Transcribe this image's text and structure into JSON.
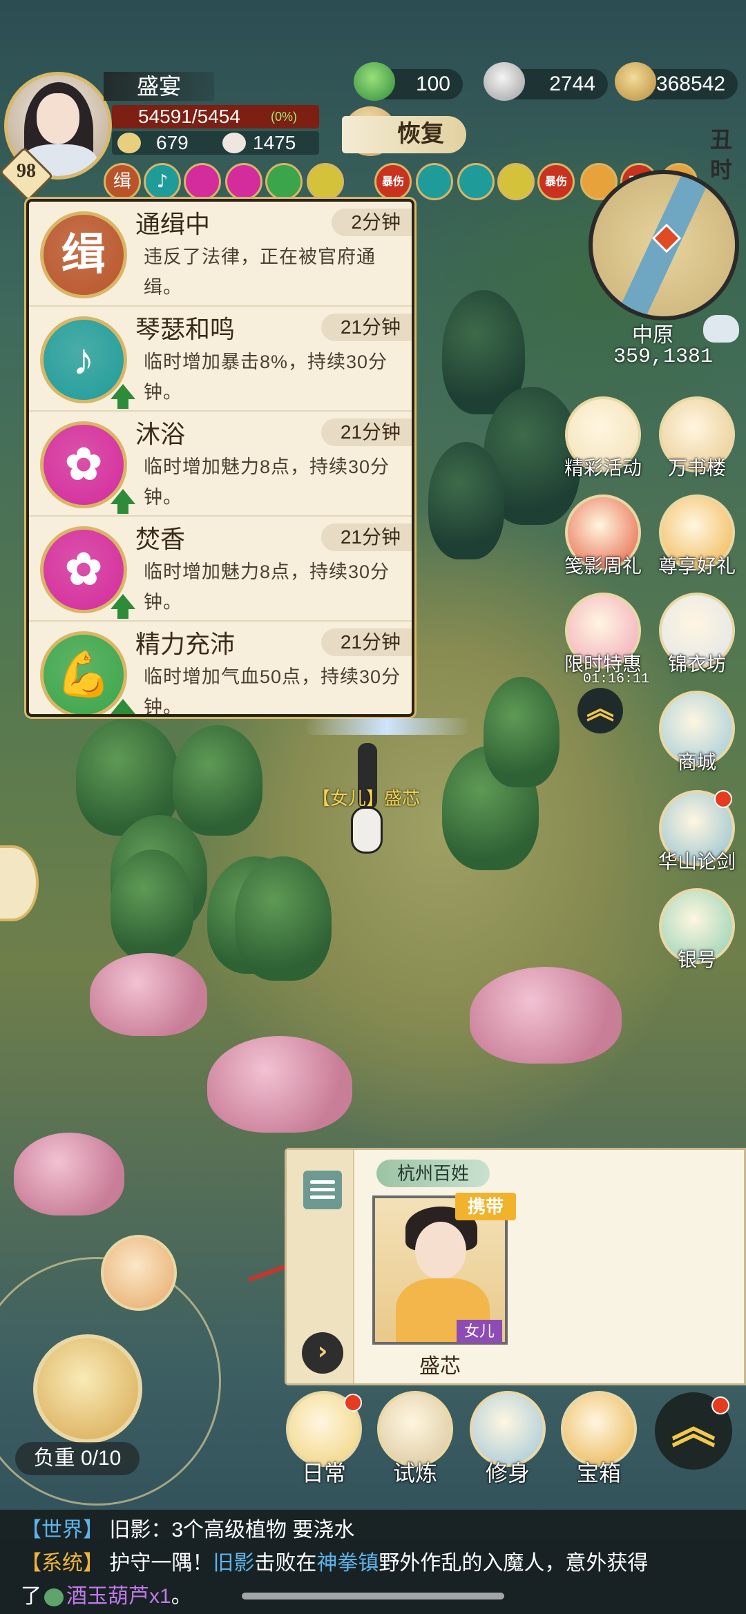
{
  "player": {
    "name": "盛宴",
    "level": "98",
    "hp": "54591/5454",
    "hp_percent": "(0%)",
    "stat1": "679",
    "stat2": "1475"
  },
  "resources": {
    "jade": "100",
    "silver": "2744",
    "coins": "368542"
  },
  "restore_label": "恢复",
  "time_label": "丑时",
  "buffs": [
    {
      "name": "缉",
      "icon": "wanted-icon",
      "color": "#b9542a"
    },
    {
      "name": "♪",
      "icon": "music-note-icon",
      "color": "#1f9c9a"
    },
    {
      "name": "",
      "icon": "blossom-icon",
      "color": "#d42b9d"
    },
    {
      "name": "",
      "icon": "blossom-icon",
      "color": "#d42b9d"
    },
    {
      "name": "",
      "icon": "strength-icon",
      "color": "#3aa54a"
    },
    {
      "name": "",
      "icon": "bowl-icon",
      "color": "#d4c23a"
    },
    {
      "name": "暴伤",
      "icon": "crit-icon",
      "color": "#c8321f"
    },
    {
      "name": "",
      "icon": "feather-icon",
      "color": "#1f9c9a"
    },
    {
      "name": "",
      "icon": "feather-icon",
      "color": "#1f9c9a"
    },
    {
      "name": "",
      "icon": "bowl-icon",
      "color": "#d4c23a"
    },
    {
      "name": "暴伤",
      "icon": "crit-icon",
      "color": "#c8321f"
    },
    {
      "name": "",
      "icon": "sword-icon",
      "color": "#e7a23b"
    },
    {
      "name": "暴伤",
      "icon": "crit-icon",
      "color": "#c8321f"
    },
    {
      "name": "",
      "icon": "sword-icon",
      "color": "#e7a23b"
    }
  ],
  "buff_panel": [
    {
      "title": "通缉中",
      "time": "2分钟",
      "desc": "违反了法律，正在被官府通缉。",
      "glyph": "缉",
      "color": "#b9542a",
      "arrow": false
    },
    {
      "title": "琴瑟和鸣",
      "time": "21分钟",
      "desc": "临时增加暴击8%，持续30分钟。",
      "glyph": "♪",
      "color": "#1f9c9a",
      "arrow": true
    },
    {
      "title": "沐浴",
      "time": "21分钟",
      "desc": "临时增加魅力8点，持续30分钟。",
      "glyph": "✿",
      "color": "#d42b9d",
      "arrow": true
    },
    {
      "title": "焚香",
      "time": "21分钟",
      "desc": "临时增加魅力8点，持续30分钟。",
      "glyph": "✿",
      "color": "#d42b9d",
      "arrow": true
    },
    {
      "title": "精力充沛",
      "time": "21分钟",
      "desc": "临时增加气血50点，持续30分钟。",
      "glyph": "💪",
      "color": "#3aa54a",
      "arrow": true
    }
  ],
  "minimap": {
    "region": "中原",
    "coords": "359,1381"
  },
  "side_menu": [
    {
      "label": "精彩活动",
      "icon": "scroll-icon"
    },
    {
      "label": "万书楼",
      "icon": "books-icon"
    },
    {
      "label": "笺影周礼",
      "icon": "gift-bag-icon"
    },
    {
      "label": "尊享好礼",
      "icon": "treasure-icon"
    },
    {
      "label": "限时特惠",
      "icon": "pouch-icon"
    },
    {
      "label": "锦衣坊",
      "icon": "robe-icon"
    },
    {
      "label": "商城",
      "icon": "shop-icon"
    },
    {
      "label": "华山论剑",
      "icon": "stone-icon"
    },
    {
      "label": "银号",
      "icon": "bank-icon"
    }
  ],
  "limited_timer": "01:16:11",
  "map_player_label": "【女儿】盛芯",
  "npc_card": {
    "tag": "杭州百姓",
    "carry_label": "携带",
    "role": "女儿",
    "name": "盛芯"
  },
  "load": "负重 0/10",
  "bottom_nav": [
    {
      "label": "日常",
      "icon": "daily-icon",
      "dot": true
    },
    {
      "label": "试炼",
      "icon": "trial-icon",
      "dot": false
    },
    {
      "label": "修身",
      "icon": "cultivate-icon",
      "dot": false
    },
    {
      "label": "宝箱",
      "icon": "chest-icon",
      "dot": false
    }
  ],
  "chat": {
    "line1_tag": "【世界】",
    "line1_text": "旧影：3个高级植物 要浇水",
    "line2_tag": "【系统】",
    "line2_a": "护守一隅！",
    "line2_b": "旧影",
    "line2_c": "击败在",
    "line2_d": "神拳镇",
    "line2_e": "野外作乱的入魔人，意外获得",
    "line3_a": "了",
    "line3_item": "酒玉葫芦x1",
    "line3_b": "。"
  }
}
